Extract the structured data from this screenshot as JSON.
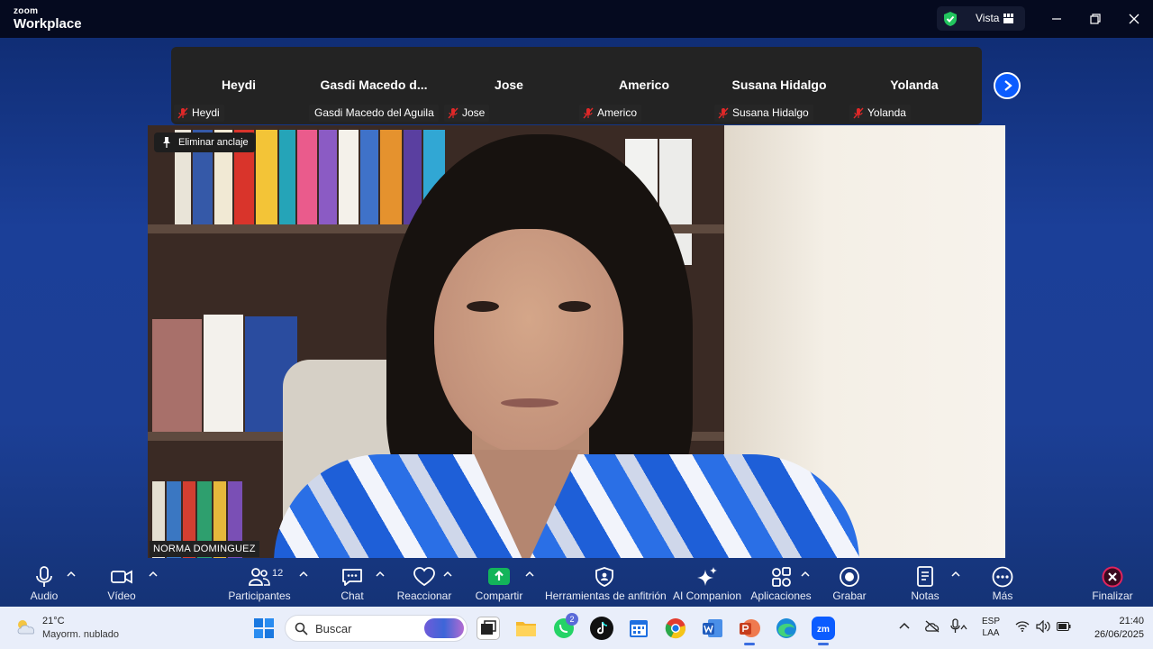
{
  "app": {
    "logo_line1": "zoom",
    "logo_line2": "Workplace",
    "view_label": "Vista"
  },
  "participants": [
    {
      "name": "Heydi",
      "tag": "Heydi"
    },
    {
      "name": "Gasdi  Macedo  d...",
      "tag": "Gasdi Macedo del Aguila"
    },
    {
      "name": "Jose",
      "tag": "Jose"
    },
    {
      "name": "Americo",
      "tag": "Americo"
    },
    {
      "name": "Susana Hidalgo",
      "tag": "Susana Hidalgo"
    },
    {
      "name": "Yolanda",
      "tag": "Yolanda"
    }
  ],
  "video": {
    "unpin_label": "Eliminar anclaje",
    "speaker_name": "NORMA DOMINGUEZ"
  },
  "toolbar": {
    "audio": "Audio",
    "video": "Vídeo",
    "participants": "Participantes",
    "participants_count": "12",
    "chat": "Chat",
    "react": "Reaccionar",
    "share": "Compartir",
    "host_tools": "Herramientas de anfitrión",
    "ai_companion": "AI Companion",
    "apps": "Aplicaciones",
    "record": "Grabar",
    "notes": "Notas",
    "more": "Más",
    "end": "Finalizar"
  },
  "taskbar": {
    "weather_temp": "21°C",
    "weather_desc": "Mayorm. nublado",
    "search_placeholder": "Buscar",
    "whatsapp_badge": "2",
    "lang_line1": "ESP",
    "lang_line2": "LAA",
    "time": "21:40",
    "date": "26/06/2025"
  },
  "colors": {
    "accent_blue": "#0b5cff",
    "share_green": "#13b45a",
    "end_red": "#e0245e",
    "muted_red": "#e02828"
  }
}
